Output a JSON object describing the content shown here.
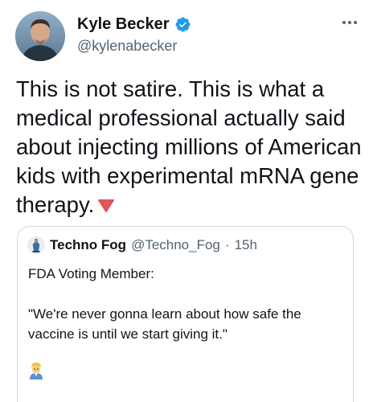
{
  "tweet": {
    "author": {
      "display_name": "Kyle Becker",
      "handle": "@kylenabecker",
      "verified": true,
      "avatar_icon": "user-avatar"
    },
    "more_icon": "more-horizontal-icon",
    "text": "This is not satire. This is what a medical professional actually said about injecting millions of American kids with experimental mRNA gene therapy.",
    "text_emoji": "red-triangle-down-icon"
  },
  "quoted_tweet": {
    "display_name": "Techno Fog",
    "handle": "@Techno_Fog",
    "separator": "·",
    "time": "15h",
    "line1": "FDA Voting Member:",
    "line2": "\"We're never gonna learn about how safe the vaccine is until we start giving it.\"",
    "emoji": "person-emoji-icon"
  },
  "colors": {
    "text_primary": "#0f1419",
    "text_secondary": "#536471",
    "verified_blue": "#1d9bf0",
    "card_border": "#cfd9de",
    "triangle_red": "#e0565b"
  }
}
